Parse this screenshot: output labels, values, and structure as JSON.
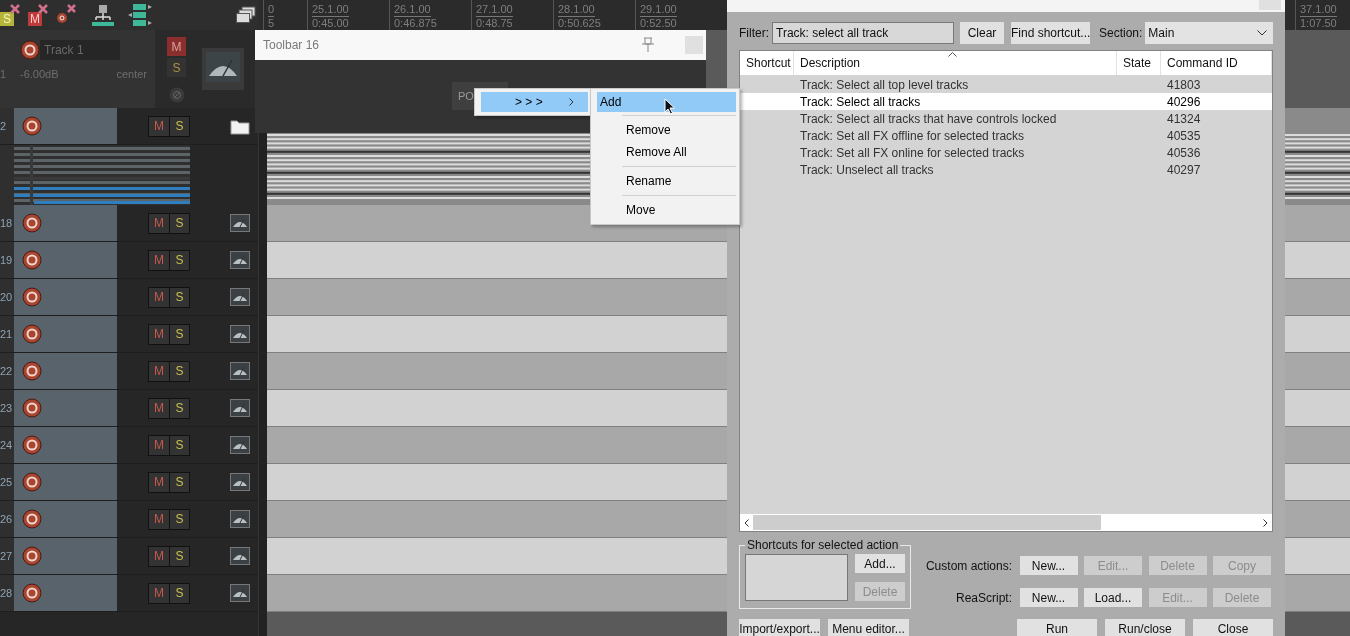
{
  "toolbar": {
    "buttons": [
      {
        "kind": "solo",
        "label": "S"
      },
      {
        "kind": "mute",
        "label": "M"
      },
      {
        "kind": "arm"
      },
      {
        "kind": "routing"
      },
      {
        "kind": "envelopes"
      },
      {
        "kind": "windows"
      }
    ]
  },
  "ruler": {
    "marks": [
      {
        "bar": "0",
        "time": "5"
      },
      {
        "bar": "25.1.00",
        "time": "0:45.00"
      },
      {
        "bar": "26.1.00",
        "time": "0:46.875"
      },
      {
        "bar": "27.1.00",
        "time": "0:48.75"
      },
      {
        "bar": "28.1.00",
        "time": "0:50.625"
      },
      {
        "bar": "29.1.00",
        "time": "0:52.50"
      },
      {
        "bar": "37.1.00",
        "time": "1:07.50"
      }
    ]
  },
  "master_track": {
    "number": "1",
    "name": "Track 1",
    "volume": "-6.00dB",
    "pan": "center",
    "mute": "M",
    "solo": "S",
    "muted": true
  },
  "tracks": [
    {
      "number": "2",
      "kind": "folder",
      "mute": "M",
      "solo": "S"
    },
    {
      "number": "18",
      "kind": "audio",
      "mute": "M",
      "solo": "S"
    },
    {
      "number": "19",
      "kind": "audio",
      "mute": "M",
      "solo": "S"
    },
    {
      "number": "20",
      "kind": "audio",
      "mute": "M",
      "solo": "S"
    },
    {
      "number": "21",
      "kind": "audio",
      "mute": "M",
      "solo": "S"
    },
    {
      "number": "22",
      "kind": "audio",
      "mute": "M",
      "solo": "S"
    },
    {
      "number": "23",
      "kind": "audio",
      "mute": "M",
      "solo": "S"
    },
    {
      "number": "24",
      "kind": "audio",
      "mute": "M",
      "solo": "S"
    },
    {
      "number": "25",
      "kind": "audio",
      "mute": "M",
      "solo": "S"
    },
    {
      "number": "26",
      "kind": "audio",
      "mute": "M",
      "solo": "S"
    },
    {
      "number": "27",
      "kind": "audio",
      "mute": "M",
      "solo": "S"
    },
    {
      "number": "28",
      "kind": "audio",
      "mute": "M",
      "solo": "S"
    }
  ],
  "toolbar_window": {
    "title": "Toolbar 16",
    "button": "PO"
  },
  "context_menu": {
    "items": [
      {
        "label": "> > >",
        "selected": true
      }
    ],
    "submenu": [
      {
        "label": "Add",
        "selected": true,
        "separator_before": false
      },
      {
        "label": "Remove",
        "selected": false,
        "separator_before": true
      },
      {
        "label": "Remove All",
        "selected": false,
        "separator_before": false
      },
      {
        "label": "Rename",
        "selected": false,
        "separator_before": true
      },
      {
        "label": "Move",
        "selected": false,
        "separator_before": true
      }
    ]
  },
  "actions": {
    "filter_label": "Filter:",
    "filter": "Track: select all track",
    "clear": "Clear",
    "find": "Find shortcut...",
    "section_label": "Section:",
    "section": "Main",
    "columns": [
      "Shortcut",
      "Description",
      "State",
      "Command ID"
    ],
    "rows": [
      {
        "description": "Track: Select all top level tracks",
        "command_id": "41803",
        "selected": false
      },
      {
        "description": "Track: Select all tracks",
        "command_id": "40296",
        "selected": true
      },
      {
        "description": "Track: Select all tracks that have controls locked",
        "command_id": "41324",
        "selected": false
      },
      {
        "description": "Track: Set all FX offline for selected tracks",
        "command_id": "40535",
        "selected": false
      },
      {
        "description": "Track: Set all FX online for selected tracks",
        "command_id": "40536",
        "selected": false
      },
      {
        "description": "Track: Unselect all tracks",
        "command_id": "40297",
        "selected": false
      }
    ],
    "shortcuts_group": "Shortcuts for selected action",
    "shortcut_buttons": [
      {
        "label": "Add...",
        "disabled": false
      },
      {
        "label": "Delete",
        "disabled": true
      }
    ],
    "custom_actions": {
      "label": "Custom actions:",
      "buttons": [
        {
          "label": "New...",
          "disabled": false
        },
        {
          "label": "Edit...",
          "disabled": true
        },
        {
          "label": "Delete",
          "disabled": true
        },
        {
          "label": "Copy",
          "disabled": true
        }
      ]
    },
    "reascript": {
      "label": "ReaScript:",
      "buttons": [
        {
          "label": "New...",
          "disabled": false
        },
        {
          "label": "Load...",
          "disabled": false
        },
        {
          "label": "Edit...",
          "disabled": true
        },
        {
          "label": "Delete",
          "disabled": true
        }
      ]
    },
    "left_buttons": [
      "Import/export...",
      "Menu editor..."
    ],
    "right_buttons": [
      "Run",
      "Run/close",
      "Close"
    ]
  }
}
